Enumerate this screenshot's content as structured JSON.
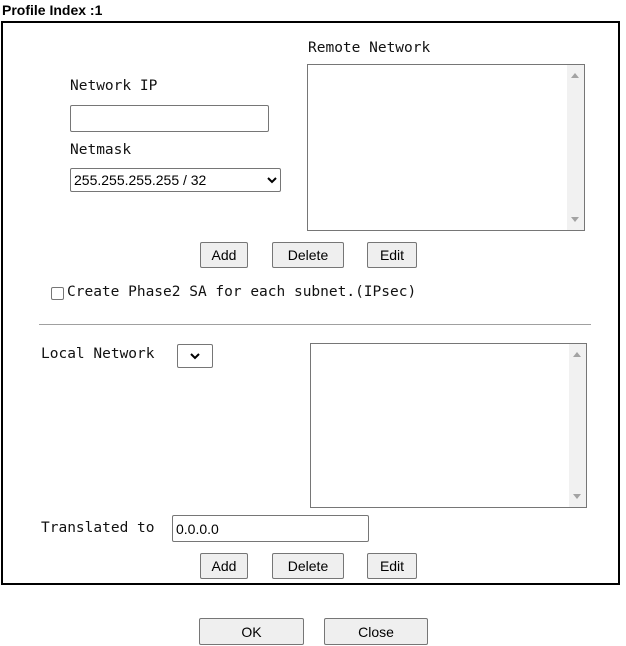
{
  "title": "Profile Index :1",
  "remote": {
    "heading": "Remote Network",
    "network_ip_label": "Network IP",
    "network_ip_value": "",
    "netmask_label": "Netmask",
    "netmask_value": "255.255.255.255 / 32",
    "add_label": "Add",
    "delete_label": "Delete",
    "edit_label": "Edit"
  },
  "phase2": {
    "label": "Create Phase2 SA for each subnet.(IPsec)",
    "checked": false
  },
  "local": {
    "label": "Local Network",
    "select_value": "",
    "translated_label": "Translated to",
    "translated_value": "0.0.0.0",
    "add_label": "Add",
    "delete_label": "Delete",
    "edit_label": "Edit"
  },
  "footer": {
    "ok_label": "OK",
    "close_label": "Close"
  },
  "icons": {
    "dropdown": "chevron-down-icon",
    "scroll_up": "scroll-up-arrow-icon",
    "scroll_down": "scroll-down-arrow-icon"
  }
}
